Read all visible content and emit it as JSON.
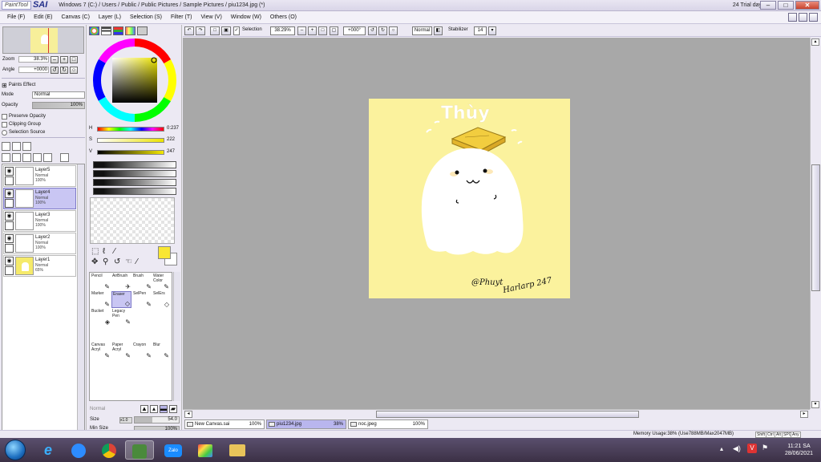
{
  "titlebar": {
    "logo_paint": "PaintTool",
    "logo_sai": "SAI",
    "window_title": "Windows 7 (C:) / Users / Public / Public Pictures / Sample Pictures / piu1234.jpg (*)",
    "trial": "24 Trial day"
  },
  "menu": [
    "File (F)",
    "Edit (E)",
    "Canvas (C)",
    "Layer (L)",
    "Selection (S)",
    "Filter (T)",
    "View (V)",
    "Window (W)",
    "Others (O)"
  ],
  "navigator": {
    "zoom_label": "Zoom",
    "zoom_value": "38.3%",
    "angle_label": "Angle",
    "angle_value": "+0000"
  },
  "layer_props": {
    "paints_effect": "Paints Effect",
    "mode_label": "Mode",
    "mode_value": "Normal",
    "opacity_label": "Opacity",
    "opacity_value": "100%",
    "preserve_opacity": "Preserve Opacity",
    "clipping_group": "Clipping Group",
    "selection_source": "Selection Source"
  },
  "layers": [
    {
      "name": "Layer5",
      "mode": "Normal",
      "opacity": "100%",
      "selected": false,
      "yellow": false
    },
    {
      "name": "Layer4",
      "mode": "Normal",
      "opacity": "100%",
      "selected": true,
      "yellow": false
    },
    {
      "name": "Layer3",
      "mode": "Normal",
      "opacity": "100%",
      "selected": false,
      "yellow": false
    },
    {
      "name": "Layer2",
      "mode": "Normal",
      "opacity": "100%",
      "selected": false,
      "yellow": false
    },
    {
      "name": "Layer1",
      "mode": "Normal",
      "opacity": "65%",
      "selected": false,
      "yellow": true
    }
  ],
  "color": {
    "h_label": "H",
    "h_value": "0:237",
    "s_label": "S",
    "s_value": "222",
    "v_label": "V",
    "v_value": "247",
    "foreground": "#f8e633"
  },
  "tools": [
    {
      "label": "Pencil",
      "icon": "✎",
      "col": 0,
      "row": 0
    },
    {
      "label": "AirBrush",
      "icon": "✈",
      "col": 1,
      "row": 0
    },
    {
      "label": "Brush",
      "icon": "🖌",
      "col": 2,
      "row": 0
    },
    {
      "label": "Water Color",
      "icon": "🖌",
      "col": 3,
      "row": 0
    },
    {
      "label": "Marker",
      "icon": "✎",
      "col": 0,
      "row": 1
    },
    {
      "label": "Eraser",
      "icon": "◇",
      "col": 1,
      "row": 1,
      "selected": true
    },
    {
      "label": "SelPen",
      "icon": "✎",
      "col": 2,
      "row": 1
    },
    {
      "label": "SelErs",
      "icon": "◇",
      "col": 3,
      "row": 1
    },
    {
      "label": "Bucket",
      "icon": "◈",
      "col": 0,
      "row": 2
    },
    {
      "label": "Legacy Pen",
      "icon": "✎",
      "col": 1,
      "row": 2
    },
    {
      "label": "Canvas Acryl",
      "icon": "✎",
      "col": 0,
      "row": 4
    },
    {
      "label": "Paper Acryl",
      "icon": "✎",
      "col": 1,
      "row": 4
    },
    {
      "label": "Crayon",
      "icon": "✎",
      "col": 2,
      "row": 4
    },
    {
      "label": "Blur",
      "icon": "✎",
      "col": 3,
      "row": 4
    }
  ],
  "tool_options": {
    "mode_value": "Normal",
    "size_label": "Size",
    "size_mult": "x1.0",
    "size_value": "54.0",
    "min_size_label": "Min Size",
    "min_size_value": "100%"
  },
  "toolbar": {
    "selection_label": "Selection",
    "zoom_value": "38.29%",
    "angle_value": "+000°",
    "mode_value": "Normal",
    "stabilizer_label": "Stabilizer",
    "stabilizer_value": "14"
  },
  "artwork": {
    "title_text": "Thùy",
    "signature_1": "@Phuyt",
    "signature_2": "Harlarp 247",
    "background": "#fbf29d"
  },
  "doc_tabs": [
    {
      "name": "New Canvas.sai",
      "zoom": "100%",
      "selected": false
    },
    {
      "name": "piu1234.jpg",
      "zoom": "38%",
      "selected": true
    },
    {
      "name": "noc.jpeg",
      "zoom": "100%",
      "selected": false
    }
  ],
  "status": {
    "memory": "Memory Usage:38% (Use788MB/Max2047MB)",
    "indicators": [
      "Shift",
      "Ctrl",
      "Alt",
      "SPC",
      "Any"
    ]
  },
  "taskbar": {
    "time": "11:21 SA",
    "date": "28/06/2021",
    "apps": [
      "ie-icon",
      "zoom-icon",
      "chrome-icon",
      "paintsai-icon",
      "zalo-icon",
      "paint-icon",
      "folder-icon"
    ],
    "zalo_label": "Zalo"
  }
}
